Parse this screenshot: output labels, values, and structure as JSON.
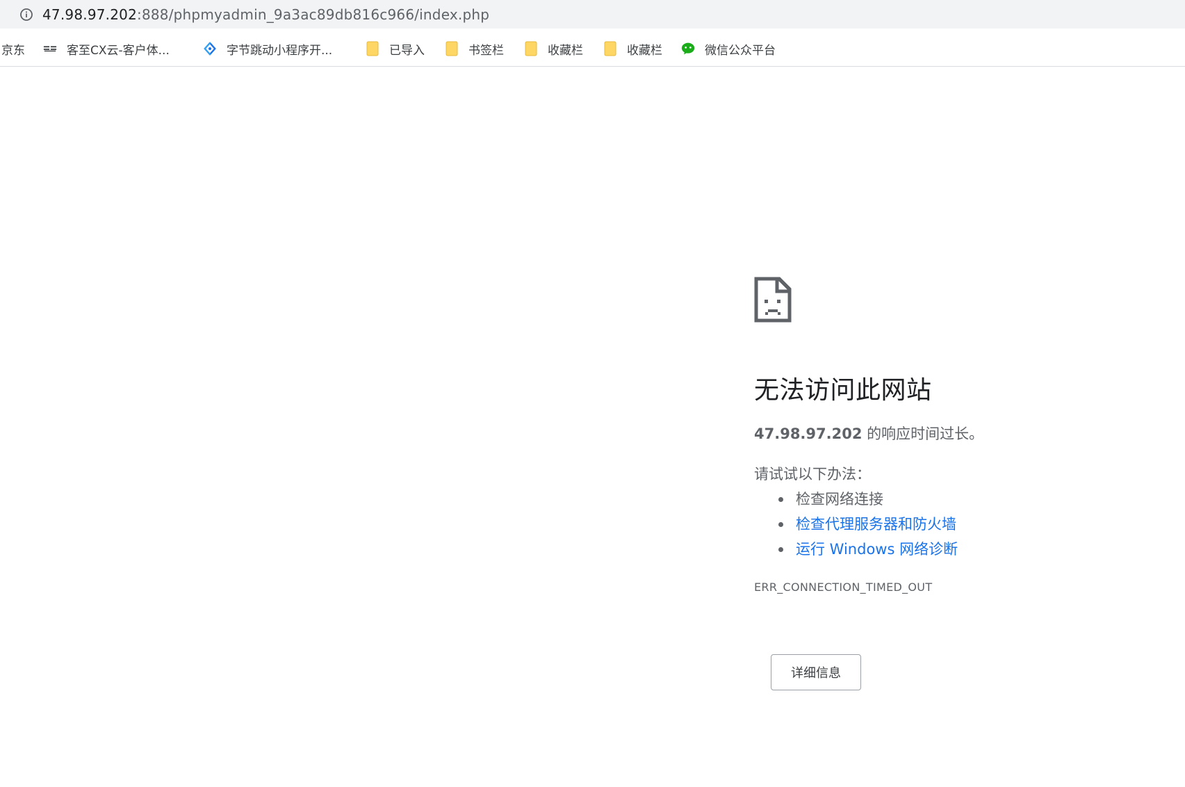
{
  "address_bar": {
    "host": "47.98.97.202",
    "path": ":888/phpmyadmin_9a3ac89db816c966/index.php",
    "icon": "info-icon"
  },
  "bookmarks": [
    {
      "label": "京东",
      "icon": ""
    },
    {
      "label": "客至CX云-客户体...",
      "icon": "kezhi-logo-icon"
    },
    {
      "label": "字节跳动小程序开...",
      "icon": "bytedance-icon"
    },
    {
      "label": "已导入",
      "icon": "folder-icon"
    },
    {
      "label": "书签栏",
      "icon": "folder-icon"
    },
    {
      "label": "收藏栏",
      "icon": "folder-icon"
    },
    {
      "label": "收藏栏",
      "icon": "folder-icon"
    },
    {
      "label": "微信公众平台",
      "icon": "wechat-icon"
    }
  ],
  "error": {
    "icon": "sad-page-icon",
    "title": "无法访问此网站",
    "host_bold": "47.98.97.202",
    "message_suffix": " 的响应时间过长。",
    "suggest_heading": "请试试以下办法：",
    "suggestions": [
      {
        "text": "检查网络连接",
        "link": false
      },
      {
        "text": "检查代理服务器和防火墙",
        "link": true
      },
      {
        "text": "运行 Windows 网络诊断",
        "link": true
      }
    ],
    "code": "ERR_CONNECTION_TIMED_OUT",
    "details_button": "详细信息"
  },
  "colors": {
    "link": "#1a73e8",
    "text_secondary": "#5f6368",
    "folder": "#fdd663"
  }
}
